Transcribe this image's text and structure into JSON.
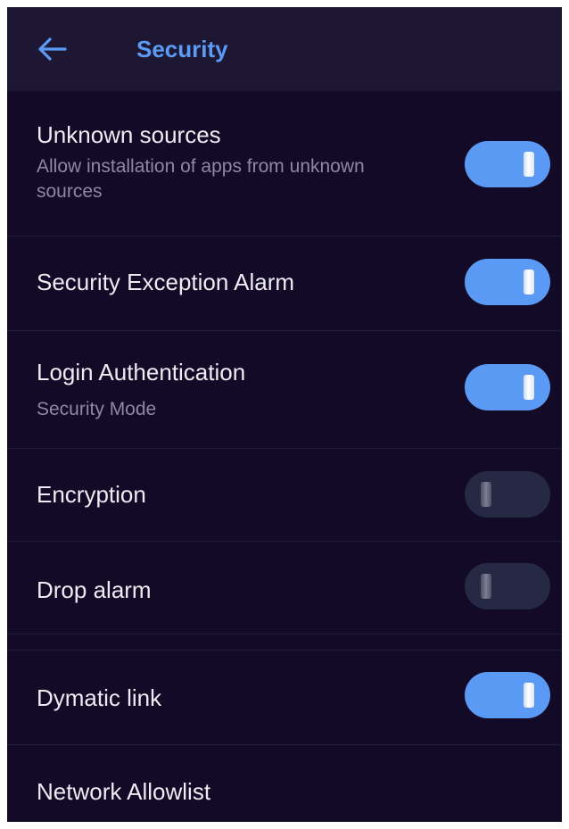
{
  "header": {
    "title": "Security",
    "back_icon": "arrow-left-icon"
  },
  "colors": {
    "background": "#120a26",
    "header_background": "#1d1733",
    "accent": "#5a9af4",
    "title": "#5b9bf5",
    "toggle_off": "#252944"
  },
  "settings": [
    {
      "title": "Unknown sources",
      "subtitle": "Allow installation of apps from unknown sources",
      "enabled": true
    },
    {
      "title": "Security Exception Alarm",
      "subtitle": "",
      "enabled": true
    },
    {
      "title": "Login Authentication",
      "subtitle": "Security Mode",
      "enabled": true
    },
    {
      "title": "Encryption",
      "subtitle": "",
      "enabled": false
    },
    {
      "title": "Drop alarm",
      "subtitle": "",
      "enabled": false
    },
    {
      "title": "Dymatic link",
      "subtitle": "",
      "enabled": true
    },
    {
      "title": "Network Allowlist",
      "subtitle": ""
    }
  ]
}
